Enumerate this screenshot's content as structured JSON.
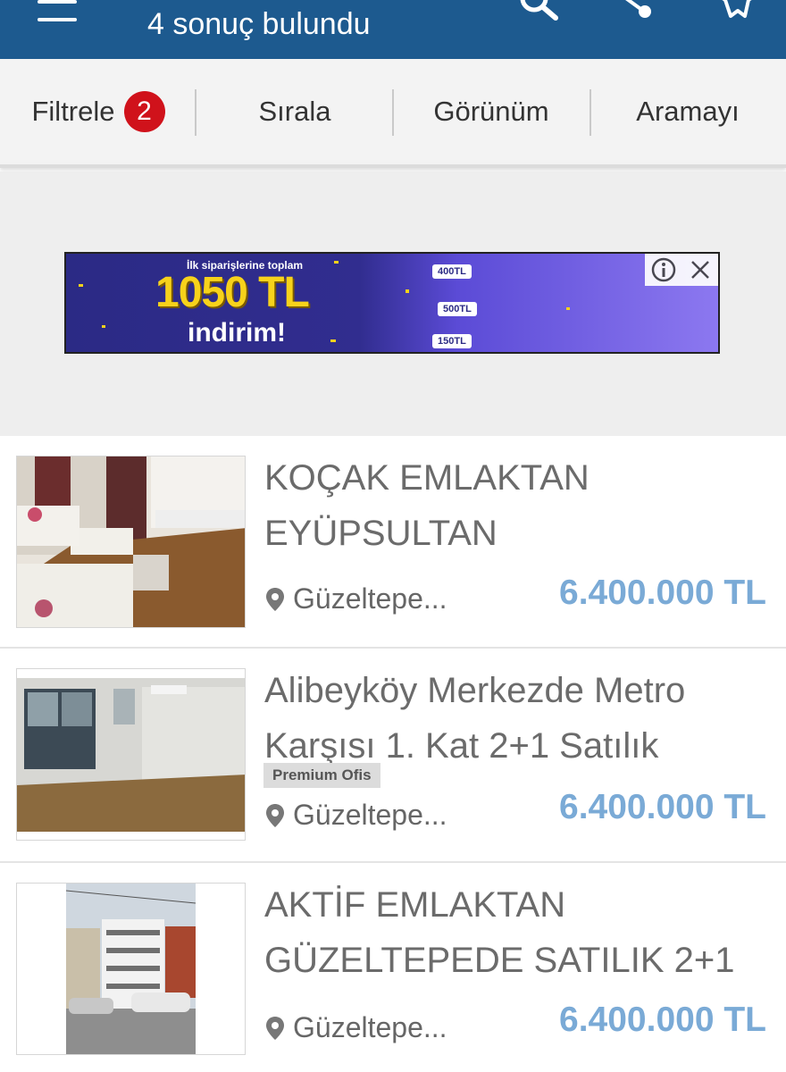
{
  "header": {
    "title": "4 sonuç bulundu",
    "background": "#1d5a8f"
  },
  "toolbar": {
    "filter_label": "Filtrele",
    "filter_count": "2",
    "sort_label": "Sırala",
    "view_label": "Görünüm",
    "save_search_label": "Aramayı"
  },
  "ad": {
    "line1": "İlk siparişlerine toplam",
    "amount": "1050 TL",
    "line2": "indirim!",
    "tag1": "400TL",
    "tag2": "500TL",
    "tag3": "150TL"
  },
  "listings": [
    {
      "title": "KOÇAK EMLAKTAN EYÜPSULTAN",
      "location": "Güzeltepe...",
      "price": "6.400.000 TL",
      "badge": ""
    },
    {
      "title": "Alibeyköy Merkezde Metro Karşısı 1. Kat 2+1 Satılık",
      "location": "Güzeltepe...",
      "price": "6.400.000 TL",
      "badge": "Premium Ofis"
    },
    {
      "title": "AKTİF EMLAKTAN GÜZELTEPEDE SATILIK 2+1",
      "location": "Güzeltepe...",
      "price": "6.400.000 TL",
      "badge": ""
    }
  ],
  "icons": {
    "menu": "hamburger-menu-icon",
    "search": "search-icon",
    "share": "share-icon",
    "favorite": "star-icon",
    "location": "map-pin-icon",
    "ad_info": "info-icon",
    "ad_close": "close-icon"
  }
}
